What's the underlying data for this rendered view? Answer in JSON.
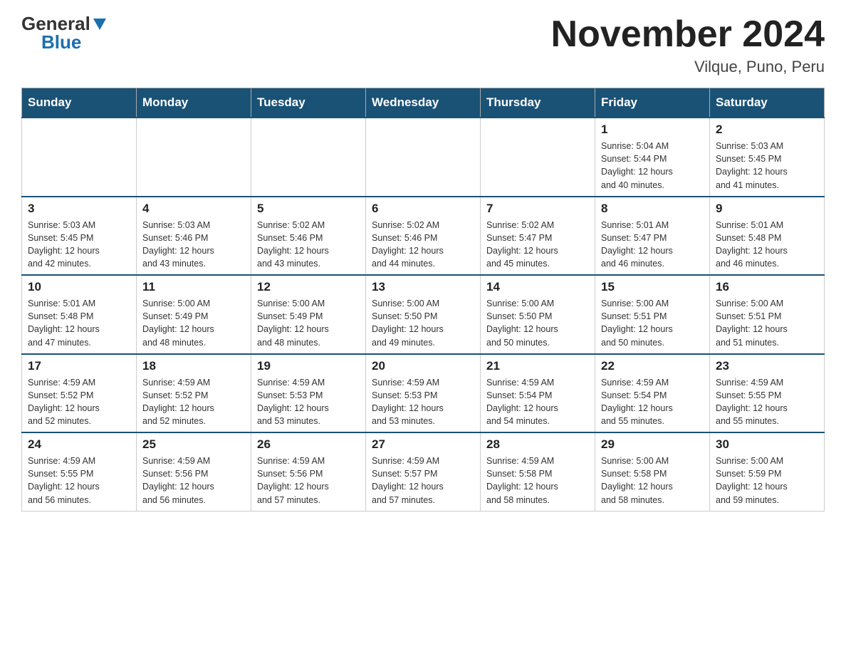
{
  "header": {
    "logo_general": "General",
    "logo_blue": "Blue",
    "month_title": "November 2024",
    "location": "Vilque, Puno, Peru"
  },
  "days_of_week": [
    "Sunday",
    "Monday",
    "Tuesday",
    "Wednesday",
    "Thursday",
    "Friday",
    "Saturday"
  ],
  "weeks": [
    [
      {
        "day": "",
        "info": ""
      },
      {
        "day": "",
        "info": ""
      },
      {
        "day": "",
        "info": ""
      },
      {
        "day": "",
        "info": ""
      },
      {
        "day": "",
        "info": ""
      },
      {
        "day": "1",
        "info": "Sunrise: 5:04 AM\nSunset: 5:44 PM\nDaylight: 12 hours\nand 40 minutes."
      },
      {
        "day": "2",
        "info": "Sunrise: 5:03 AM\nSunset: 5:45 PM\nDaylight: 12 hours\nand 41 minutes."
      }
    ],
    [
      {
        "day": "3",
        "info": "Sunrise: 5:03 AM\nSunset: 5:45 PM\nDaylight: 12 hours\nand 42 minutes."
      },
      {
        "day": "4",
        "info": "Sunrise: 5:03 AM\nSunset: 5:46 PM\nDaylight: 12 hours\nand 43 minutes."
      },
      {
        "day": "5",
        "info": "Sunrise: 5:02 AM\nSunset: 5:46 PM\nDaylight: 12 hours\nand 43 minutes."
      },
      {
        "day": "6",
        "info": "Sunrise: 5:02 AM\nSunset: 5:46 PM\nDaylight: 12 hours\nand 44 minutes."
      },
      {
        "day": "7",
        "info": "Sunrise: 5:02 AM\nSunset: 5:47 PM\nDaylight: 12 hours\nand 45 minutes."
      },
      {
        "day": "8",
        "info": "Sunrise: 5:01 AM\nSunset: 5:47 PM\nDaylight: 12 hours\nand 46 minutes."
      },
      {
        "day": "9",
        "info": "Sunrise: 5:01 AM\nSunset: 5:48 PM\nDaylight: 12 hours\nand 46 minutes."
      }
    ],
    [
      {
        "day": "10",
        "info": "Sunrise: 5:01 AM\nSunset: 5:48 PM\nDaylight: 12 hours\nand 47 minutes."
      },
      {
        "day": "11",
        "info": "Sunrise: 5:00 AM\nSunset: 5:49 PM\nDaylight: 12 hours\nand 48 minutes."
      },
      {
        "day": "12",
        "info": "Sunrise: 5:00 AM\nSunset: 5:49 PM\nDaylight: 12 hours\nand 48 minutes."
      },
      {
        "day": "13",
        "info": "Sunrise: 5:00 AM\nSunset: 5:50 PM\nDaylight: 12 hours\nand 49 minutes."
      },
      {
        "day": "14",
        "info": "Sunrise: 5:00 AM\nSunset: 5:50 PM\nDaylight: 12 hours\nand 50 minutes."
      },
      {
        "day": "15",
        "info": "Sunrise: 5:00 AM\nSunset: 5:51 PM\nDaylight: 12 hours\nand 50 minutes."
      },
      {
        "day": "16",
        "info": "Sunrise: 5:00 AM\nSunset: 5:51 PM\nDaylight: 12 hours\nand 51 minutes."
      }
    ],
    [
      {
        "day": "17",
        "info": "Sunrise: 4:59 AM\nSunset: 5:52 PM\nDaylight: 12 hours\nand 52 minutes."
      },
      {
        "day": "18",
        "info": "Sunrise: 4:59 AM\nSunset: 5:52 PM\nDaylight: 12 hours\nand 52 minutes."
      },
      {
        "day": "19",
        "info": "Sunrise: 4:59 AM\nSunset: 5:53 PM\nDaylight: 12 hours\nand 53 minutes."
      },
      {
        "day": "20",
        "info": "Sunrise: 4:59 AM\nSunset: 5:53 PM\nDaylight: 12 hours\nand 53 minutes."
      },
      {
        "day": "21",
        "info": "Sunrise: 4:59 AM\nSunset: 5:54 PM\nDaylight: 12 hours\nand 54 minutes."
      },
      {
        "day": "22",
        "info": "Sunrise: 4:59 AM\nSunset: 5:54 PM\nDaylight: 12 hours\nand 55 minutes."
      },
      {
        "day": "23",
        "info": "Sunrise: 4:59 AM\nSunset: 5:55 PM\nDaylight: 12 hours\nand 55 minutes."
      }
    ],
    [
      {
        "day": "24",
        "info": "Sunrise: 4:59 AM\nSunset: 5:55 PM\nDaylight: 12 hours\nand 56 minutes."
      },
      {
        "day": "25",
        "info": "Sunrise: 4:59 AM\nSunset: 5:56 PM\nDaylight: 12 hours\nand 56 minutes."
      },
      {
        "day": "26",
        "info": "Sunrise: 4:59 AM\nSunset: 5:56 PM\nDaylight: 12 hours\nand 57 minutes."
      },
      {
        "day": "27",
        "info": "Sunrise: 4:59 AM\nSunset: 5:57 PM\nDaylight: 12 hours\nand 57 minutes."
      },
      {
        "day": "28",
        "info": "Sunrise: 4:59 AM\nSunset: 5:58 PM\nDaylight: 12 hours\nand 58 minutes."
      },
      {
        "day": "29",
        "info": "Sunrise: 5:00 AM\nSunset: 5:58 PM\nDaylight: 12 hours\nand 58 minutes."
      },
      {
        "day": "30",
        "info": "Sunrise: 5:00 AM\nSunset: 5:59 PM\nDaylight: 12 hours\nand 59 minutes."
      }
    ]
  ]
}
